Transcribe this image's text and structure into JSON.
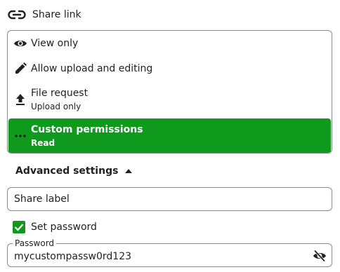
{
  "share_link": {
    "label": "Share link",
    "icon": "link-icon"
  },
  "permissions": {
    "items": [
      {
        "title": "View only",
        "subtitle": "",
        "icon": "eye-icon"
      },
      {
        "title": "Allow upload and editing",
        "subtitle": "",
        "icon": "pencil-icon"
      },
      {
        "title": "File request",
        "subtitle": "Upload only",
        "icon": "upload-icon"
      },
      {
        "title": "Custom permissions",
        "subtitle": "Read",
        "icon": "more-horizontal-icon",
        "selected": true
      }
    ],
    "selected_color": "#0f9a1d"
  },
  "advanced": {
    "label": "Advanced settings",
    "expanded": true
  },
  "share_label_field": {
    "placeholder": "Share label",
    "value": ""
  },
  "set_password": {
    "label": "Set password",
    "checked": true
  },
  "password_field": {
    "label": "Password",
    "value": "mycustompassw0rd123",
    "visibility_icon": "eye-off-icon"
  },
  "colors": {
    "accent": "#0f9a1d",
    "border": "#8a8a8a",
    "text": "#222222"
  }
}
